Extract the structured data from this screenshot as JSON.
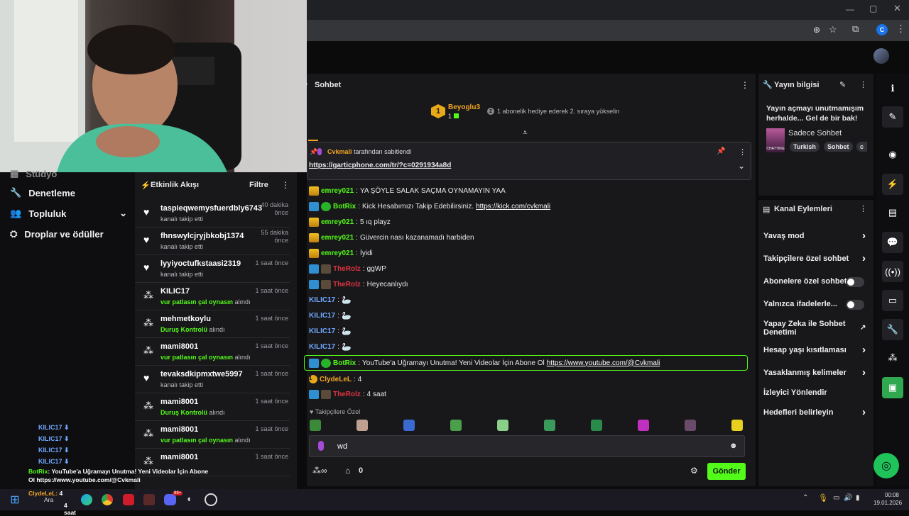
{
  "browser": {
    "icons": [
      "zoom-icon",
      "star-icon",
      "extensions-icon",
      "profile-icon",
      "menu-icon"
    ],
    "profile_initial": "C"
  },
  "left_nav": {
    "partial_item": "Stüdyo",
    "items": [
      {
        "icon": "shield-icon",
        "label": "Denetleme"
      },
      {
        "icon": "community-icon",
        "label": "Topluluk"
      },
      {
        "icon": "drops-icon",
        "label": "Droplar ve ödüller"
      }
    ]
  },
  "overlay_chat": {
    "lines": [
      "KILIC17",
      "KILIC17",
      "KILIC17",
      "KILIC17"
    ],
    "bot_user": "BotRix",
    "bot_text": "YouTube'a Uğramayı Unutma! Yeni Videolar İçin Abone Ol https://www.youtube.com/@Cvkmali",
    "tb_user1": "ClydeLeL",
    "tb_num": "4",
    "tb_text2": "4 saat"
  },
  "feed": {
    "title": "Etkinlik Akışı",
    "filter": "Filtre",
    "items": [
      {
        "type": "heart",
        "name": "taspieqwemysfuerdbly6743",
        "time": "40 dakika önce",
        "pre": "kanalı takip etti",
        "hl": "",
        "post": ""
      },
      {
        "type": "heart",
        "name": "fhnswylcjryjbkobj1374",
        "time": "55 dakika önce",
        "pre": "kanalı takip etti",
        "hl": "",
        "post": ""
      },
      {
        "type": "heart",
        "name": "lyyiyoctufkstaasi2319",
        "time": "1 saat önce",
        "pre": "kanalı takip etti",
        "hl": "",
        "post": ""
      },
      {
        "type": "drops",
        "name": "KILIC17",
        "time": "1 saat önce",
        "pre": "",
        "hl": "vur patlasın çal oynasın",
        "post": " alındı"
      },
      {
        "type": "drops",
        "name": "mehmetkoylu",
        "time": "1 saat önce",
        "pre": "",
        "hl": "Duruş Kontrolü",
        "post": " alındı"
      },
      {
        "type": "drops",
        "name": "mami8001",
        "time": "1 saat önce",
        "pre": "",
        "hl": "vur patlasın çal oynasın",
        "post": " alındı"
      },
      {
        "type": "heart",
        "name": "tevaksdkipmxtwe5997",
        "time": "1 saat önce",
        "pre": "kanalı takip etti",
        "hl": "",
        "post": ""
      },
      {
        "type": "drops",
        "name": "mami8001",
        "time": "1 saat önce",
        "pre": "",
        "hl": "Duruş Kontrolü",
        "post": " alındı"
      },
      {
        "type": "drops",
        "name": "mami8001",
        "time": "1 saat önce",
        "pre": "",
        "hl": "vur patlasın çal oynasın",
        "post": " alındı"
      },
      {
        "type": "drops",
        "name": "mami8001",
        "time": "1 saat önce",
        "pre": "",
        "hl": "",
        "post": ""
      }
    ]
  },
  "chat": {
    "title": "Sohbet",
    "leader": {
      "rank": "1",
      "name": "Beyoglu3",
      "count": "1",
      "hint_num": "2",
      "hint": "1 abonelik hediye ederek 2. sıraya yükselin"
    },
    "pinned": {
      "user": "Cvkmali",
      "suffix": " tarafından sabitlendi",
      "link": "https://garticphone.com/tr/?c=0291934a8d"
    },
    "messages": [
      {
        "badges": [
          "crown"
        ],
        "user": "emrey021",
        "cls": "u-green",
        "text": "YA ŞÖYLE SALAK SAÇMA OYNAMAYIN YAA",
        "link": ""
      },
      {
        "badges": [
          "vip",
          "ver"
        ],
        "user": "BotRix",
        "cls": "u-green",
        "text": "Kick Hesabımızı Takip Edebilirsiniz.",
        "link": "https://kick.com/cvkmali"
      },
      {
        "badges": [
          "crown"
        ],
        "user": "emrey021",
        "cls": "u-green",
        "text": "5 ıq playz",
        "link": ""
      },
      {
        "badges": [
          "crown"
        ],
        "user": "emrey021",
        "cls": "u-green",
        "text": "Güvercin nası kazanamadı harbiden",
        "link": ""
      },
      {
        "badges": [
          "crown"
        ],
        "user": "emrey021",
        "cls": "u-green",
        "text": "İyidi",
        "link": ""
      },
      {
        "badges": [
          "vip",
          "sub"
        ],
        "user": "TheRolz",
        "cls": "u-red",
        "text": "ggWP",
        "link": ""
      },
      {
        "badges": [
          "vip",
          "sub"
        ],
        "user": "TheRolz",
        "cls": "u-red",
        "text": "Heyecanlıydı",
        "link": ""
      },
      {
        "badges": [],
        "user": "KILIC17",
        "cls": "u-blue",
        "text": "",
        "link": ""
      },
      {
        "badges": [],
        "user": "KILIC17",
        "cls": "u-blue",
        "text": "",
        "link": ""
      },
      {
        "badges": [],
        "user": "KILIC17",
        "cls": "u-blue",
        "text": "",
        "link": ""
      },
      {
        "badges": [],
        "user": "KILIC17",
        "cls": "u-blue",
        "text": "",
        "link": ""
      },
      {
        "badges": [
          "vip",
          "ver"
        ],
        "user": "BotRix",
        "cls": "u-green",
        "text": "YouTube'a Uğramayı Unutma! Yeni Videolar İçin Abone Ol",
        "link": "https://www.youtube.com/@Cvkmali"
      },
      {
        "badges": [
          "rank1"
        ],
        "user": "ClydeLeL",
        "cls": "u-orange",
        "text": "4",
        "link": ""
      },
      {
        "badges": [
          "vip",
          "sub"
        ],
        "user": "TheRolz",
        "cls": "u-red",
        "text": "4 saat",
        "link": ""
      }
    ],
    "emote_section": "Takipçilere Özel",
    "input_value": "wd",
    "points": "0",
    "send": "Gönder"
  },
  "stream_info": {
    "title": "Yayın bilgisi",
    "text": "Yayın açmayı unutmamışım herhalde... Gel de bir bak!",
    "category": "Sadece Sohbet",
    "thumb_label": "CHATTING",
    "tags": [
      "Turkish",
      "Sohbet",
      "c"
    ]
  },
  "channel_actions": {
    "title": "Kanal Eylemleri",
    "items": [
      {
        "label": "Yavaş mod",
        "kind": "chev"
      },
      {
        "label": "Takipçilere özel sohbet",
        "kind": "chev"
      },
      {
        "label": "Abonelere özel sohbet",
        "kind": "toggle"
      },
      {
        "label": "Yalnızca ifadelerle...",
        "kind": "toggle"
      },
      {
        "label": "Yapay Zeka ile Sohbet Denetimi",
        "kind": "ext"
      },
      {
        "label": "Hesap yaşı kısıtlaması",
        "kind": "chev"
      },
      {
        "label": "Yasaklanmış kelimeler",
        "kind": "chev"
      },
      {
        "label": "İzleyici Yönlendir",
        "kind": "none"
      },
      {
        "label": "Hedefleri belirleyin",
        "kind": "chev"
      }
    ]
  },
  "taskbar": {
    "search": "Ara",
    "time": "00:08",
    "date": "19.01.2026",
    "badge": "99+"
  },
  "colors": {
    "accent": "#53fc18",
    "panel": "#18181b",
    "background": "#0b0b0c"
  }
}
